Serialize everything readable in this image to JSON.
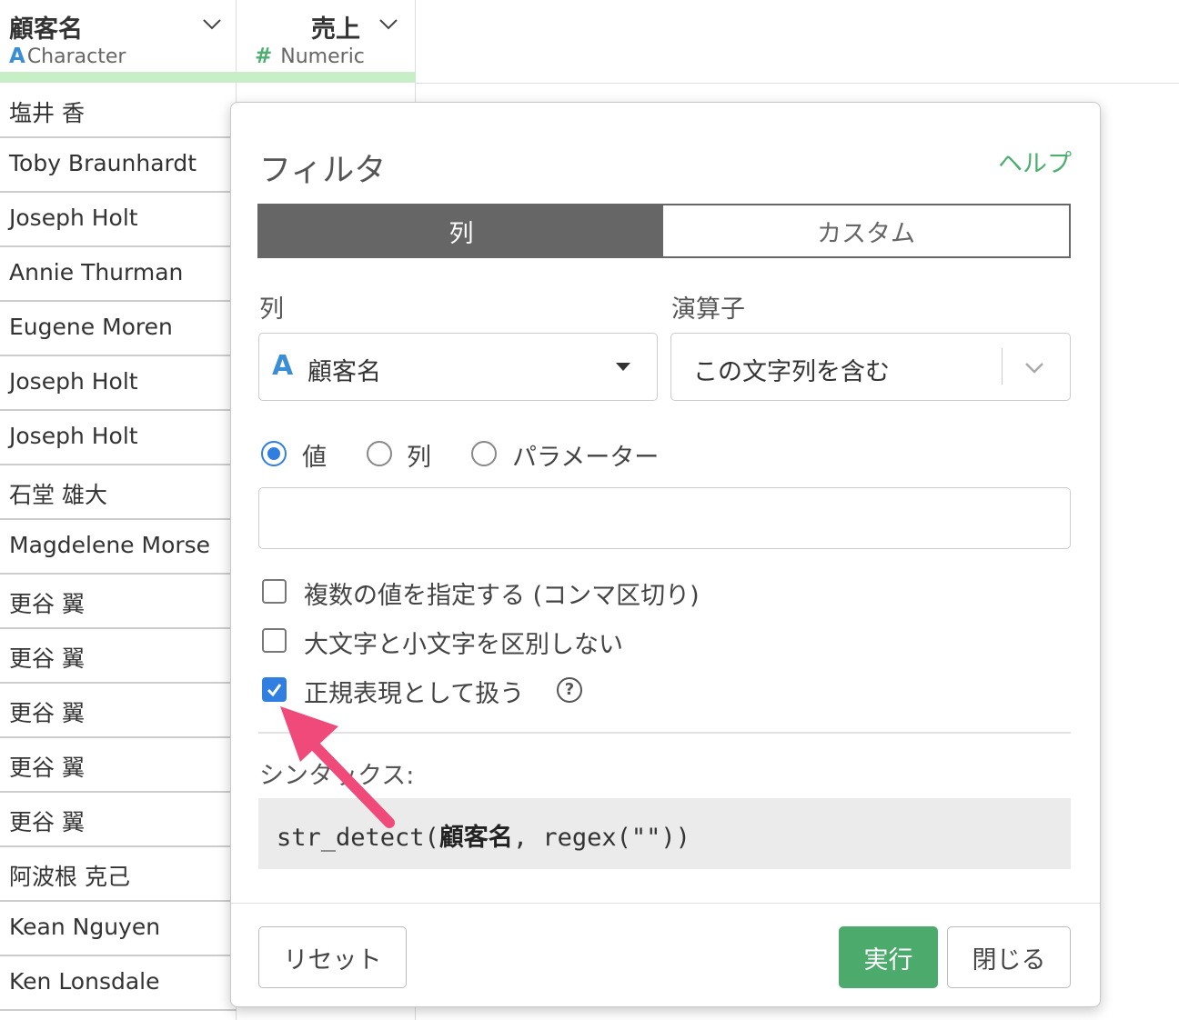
{
  "table": {
    "columns": [
      {
        "title": "顧客名",
        "type_glyph": "A",
        "type_label": "Character"
      },
      {
        "title": "売上",
        "type_glyph": "#",
        "type_label": "Numeric"
      }
    ],
    "rows": [
      "塩井 香",
      "Toby Braunhardt",
      "Joseph Holt",
      "Annie Thurman",
      "Eugene Moren",
      "Joseph Holt",
      "Joseph Holt",
      "石堂 雄大",
      "Magdelene Morse",
      "更谷 翼",
      "更谷 翼",
      "更谷 翼",
      "更谷 翼",
      "更谷 翼",
      "阿波根 克己",
      "Kean Nguyen",
      "Ken Lonsdale"
    ]
  },
  "dialog": {
    "title": "フィルタ",
    "help": "ヘルプ",
    "tabs": {
      "column": "列",
      "custom": "カスタム"
    },
    "column_label": "列",
    "operator_label": "演算子",
    "column_value": "顧客名",
    "column_type_glyph": "A",
    "operator_value": "この文字列を含む",
    "radio": {
      "value": "値",
      "column": "列",
      "parameter": "パラメーター",
      "selected": "値"
    },
    "value_input": "",
    "checkboxes": {
      "multiple": "複数の値を指定する (コンマ区切り)",
      "ignore_case": "大文字と小文字を区別しない",
      "regex": "正規表現として扱う"
    },
    "help_glyph": "?",
    "syntax_label": "シンタックス:",
    "syntax": {
      "fn": "str_detect(",
      "column": "顧客名",
      "rest": ", regex(\"\"))"
    },
    "buttons": {
      "reset": "リセット",
      "run": "実行",
      "close": "閉じる"
    }
  },
  "colors": {
    "accent_green": "#4caa6c",
    "accent_blue": "#2f7ee0",
    "arrow": "#f04a7a"
  }
}
